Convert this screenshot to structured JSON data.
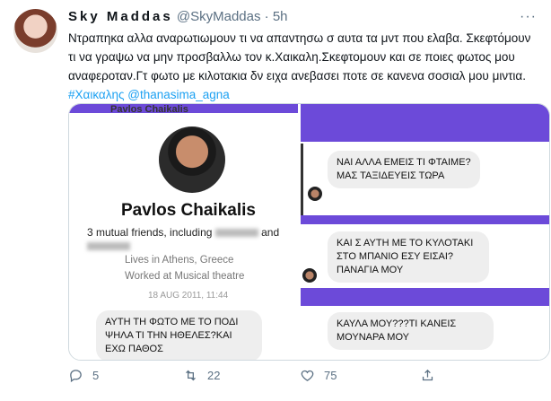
{
  "tweet": {
    "name": "Sky Maddas",
    "handle": "@SkyMaddas",
    "dot": "·",
    "time": "5h",
    "more": "···",
    "text_part1": "Ντραπηκα αλλα αναρωτιωμουν τι να απαντησω σ αυτα τα μντ που ελαβα. Σκεφτόμουν τι να γραψω να μην προσβαλλω τον κ.Χαικαλη.Σκεφτομουν και σε ποιες φωτος μου αναφεροταν.Γτ φωτο με κιλοτακια δν ειχα ανεβασει ποτε  σε κανενα σοσιαλ μου μιντια.",
    "hashtag": "#Χαικαλης",
    "mention": "@thanasima_agna"
  },
  "media_left": {
    "top_name": "Pavlos Chaikalis",
    "profile_name": "Pavlos Chaikalis",
    "mutual_prefix": "3 mutual friends, including",
    "mutual_and": "and",
    "location": "Lives in Athens, Greece",
    "work": "Worked at Musical theatre",
    "date": "18 AUG 2011, 11:44",
    "message": "ΑΥΤΗ ΤΗ ΦΩΤΟ ΜΕ ΤΟ ΠΟΔΙ ΨΗΛΑ ΤΙ ΤΗΝ ΗΘΕΛΕΣ?ΚΑΙ ΕΧΩ ΠΑΘΟΣ"
  },
  "media_right": {
    "message1": "ΝΑΙ ΑΛΛΑ ΕΜΕΙΣ ΤΙ ΦΤΑΙΜΕ?ΜΑΣ ΤΑΞΙΔΕΥΕΙΣ ΤΩΡΑ",
    "message2": "ΚΑΙ Σ ΑΥΤΗ ΜΕ ΤΟ ΚΥΛΟΤΑΚΙ ΣΤΟ ΜΠΑΝΙΟ ΕΣΥ ΕΙΣΑΙ?ΠΑΝΑΓΙΑ ΜΟΥ",
    "message3": "ΚΑΥΛΑ ΜΟΥ???ΤΙ ΚΑΝΕΙΣ ΜΟΥΝΑΡΑ ΜΟΥ"
  },
  "actions": {
    "replies": "5",
    "retweets": "22",
    "likes": "75"
  },
  "colors": {
    "accent": "#1da1f2",
    "muted": "#5b7083",
    "messenger_purple": "#6c4ad9"
  }
}
